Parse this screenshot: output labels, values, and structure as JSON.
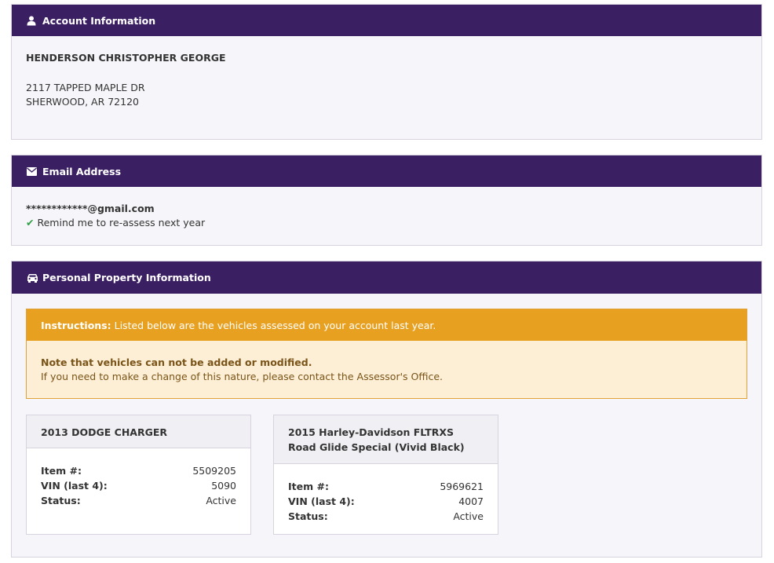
{
  "account": {
    "header": "Account Information",
    "name": "HENDERSON CHRISTOPHER GEORGE",
    "address_line1": "2117 TAPPED MAPLE DR",
    "address_line2": "SHERWOOD, AR 72120"
  },
  "email": {
    "header": "Email Address",
    "address": "************@gmail.com",
    "remind": "Remind me to re-assess next year"
  },
  "property": {
    "header": "Personal Property Information",
    "instructions_lead": "Instructions:",
    "instructions_text": "Listed below are the vehicles assessed on your account last year.",
    "note_bold": "Note that vehicles can not be added or modified.",
    "note_text": "If you need to make a change of this nature, please contact the Assessor's Office.",
    "vehicles": [
      {
        "title": "2013 DODGE CHARGER",
        "item_label": "Item #:",
        "item": "5509205",
        "vin_label": "VIN (last 4):",
        "vin": "5090",
        "status_label": "Status:",
        "status": "Active"
      },
      {
        "title": "2015 Harley-Davidson FLTRXS Road Glide Special (Vivid Black)",
        "item_label": "Item #:",
        "item": "5969621",
        "vin_label": "VIN (last 4):",
        "vin": "4007",
        "status_label": "Status:",
        "status": "Active"
      }
    ]
  },
  "colors": {
    "header_bg": "#3b1f63",
    "alert_header": "#e8a020",
    "alert_body": "#fcefd6",
    "check": "#2e9e45"
  }
}
